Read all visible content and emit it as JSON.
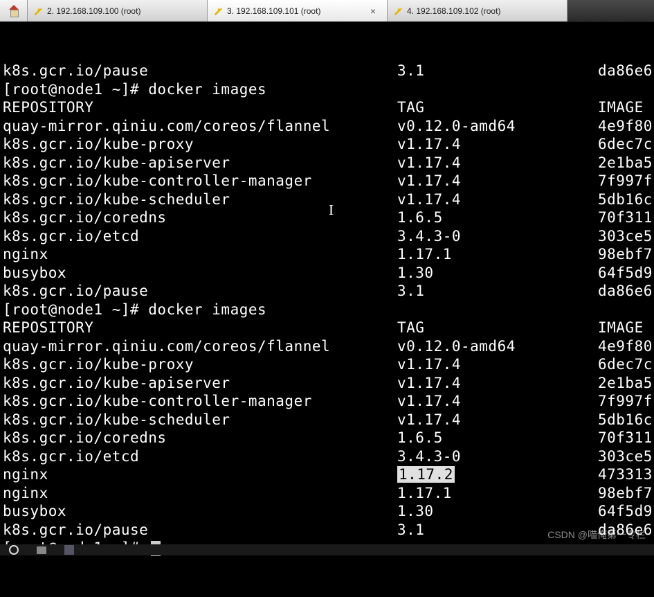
{
  "tabs": [
    {
      "label": "2. 192.168.109.100 (root)",
      "active": false
    },
    {
      "label": "3. 192.168.109.101 (root)",
      "active": true
    },
    {
      "label": "4. 192.168.109.102 (root)",
      "active": false
    }
  ],
  "pre_lines": [
    {
      "repo": "k8s.gcr.io/pause",
      "tag": "3.1",
      "image": "da86e6"
    }
  ],
  "prompt1": "[root@node1 ~]# docker images",
  "header": {
    "repo": "REPOSITORY",
    "tag": "TAG",
    "image": "IMAGE"
  },
  "block1": [
    {
      "repo": "quay-mirror.qiniu.com/coreos/flannel",
      "tag": "v0.12.0-amd64",
      "image": "4e9f80"
    },
    {
      "repo": "k8s.gcr.io/kube-proxy",
      "tag": "v1.17.4",
      "image": "6dec7c"
    },
    {
      "repo": "k8s.gcr.io/kube-apiserver",
      "tag": "v1.17.4",
      "image": "2e1ba5"
    },
    {
      "repo": "k8s.gcr.io/kube-controller-manager",
      "tag": "v1.17.4",
      "image": "7f997f"
    },
    {
      "repo": "k8s.gcr.io/kube-scheduler",
      "tag": "v1.17.4",
      "image": "5db16c"
    },
    {
      "repo": "k8s.gcr.io/coredns",
      "tag": "1.6.5",
      "image": "70f311"
    },
    {
      "repo": "k8s.gcr.io/etcd",
      "tag": "3.4.3-0",
      "image": "303ce5"
    },
    {
      "repo": "nginx",
      "tag": "1.17.1",
      "image": "98ebf7"
    },
    {
      "repo": "busybox",
      "tag": "1.30",
      "image": "64f5d9"
    },
    {
      "repo": "k8s.gcr.io/pause",
      "tag": "3.1",
      "image": "da86e6"
    }
  ],
  "prompt2": "[root@node1 ~]# docker images",
  "block2": [
    {
      "repo": "quay-mirror.qiniu.com/coreos/flannel",
      "tag": "v0.12.0-amd64",
      "image": "4e9f80"
    },
    {
      "repo": "k8s.gcr.io/kube-proxy",
      "tag": "v1.17.4",
      "image": "6dec7c"
    },
    {
      "repo": "k8s.gcr.io/kube-apiserver",
      "tag": "v1.17.4",
      "image": "2e1ba5"
    },
    {
      "repo": "k8s.gcr.io/kube-controller-manager",
      "tag": "v1.17.4",
      "image": "7f997f"
    },
    {
      "repo": "k8s.gcr.io/kube-scheduler",
      "tag": "v1.17.4",
      "image": "5db16c"
    },
    {
      "repo": "k8s.gcr.io/coredns",
      "tag": "1.6.5",
      "image": "70f311"
    },
    {
      "repo": "k8s.gcr.io/etcd",
      "tag": "3.4.3-0",
      "image": "303ce5"
    },
    {
      "repo": "nginx",
      "tag": "1.17.2",
      "image": "473313",
      "highlighted": true
    },
    {
      "repo": "nginx",
      "tag": "1.17.1",
      "image": "98ebf7"
    },
    {
      "repo": "busybox",
      "tag": "1.30",
      "image": "64f5d9"
    },
    {
      "repo": "k8s.gcr.io/pause",
      "tag": "3.1",
      "image": "da86e6"
    }
  ],
  "prompt3": "[root@node1 ~]# ",
  "cursor_char": "I",
  "watermark": "CSDN @喵俺第一专栏"
}
